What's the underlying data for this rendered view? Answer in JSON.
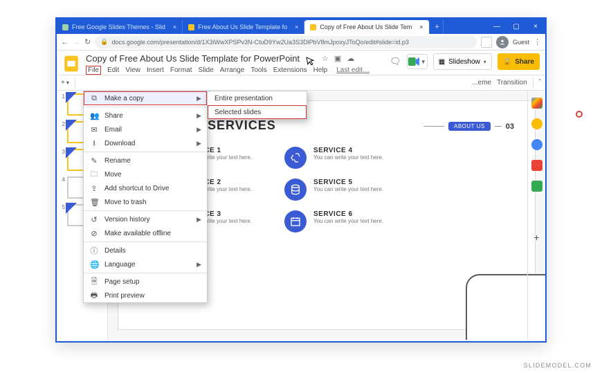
{
  "browser": {
    "tabs": [
      {
        "label": "Free Google Slides Themes - Slid"
      },
      {
        "label": "Free About Us Slide Template fo"
      },
      {
        "label": "Copy of Free About Us Slide Tem"
      }
    ],
    "url": "docs.google.com/presentation/d/1X3iWwXPSPv3N-CtuD9Yw2Ua3S3DlPbV8mJpoxyJToQo/edit#slide=id.p3",
    "guest": "Guest"
  },
  "doc": {
    "title": "Copy of Free About Us Slide Template for PowerPoint",
    "menus": [
      "File",
      "Edit",
      "View",
      "Insert",
      "Format",
      "Slide",
      "Arrange",
      "Tools",
      "Extensions",
      "Help"
    ],
    "last_edit": "Last edit…",
    "slideshow": "Slideshow",
    "share": "Share"
  },
  "file_menu": {
    "make_copy": "Make a copy",
    "share": "Share",
    "email": "Email",
    "download": "Download",
    "rename": "Rename",
    "move": "Move",
    "shortcut": "Add shortcut to Drive",
    "trash": "Move to trash",
    "version": "Version history",
    "offline": "Make available offline",
    "details": "Details",
    "language": "Language",
    "pagesetup": "Page setup",
    "printpreview": "Print preview"
  },
  "submenu": {
    "entire": "Entire presentation",
    "selected": "Selected slides"
  },
  "toolbar": {
    "theme": "...eme",
    "transition": "Transition"
  },
  "slide": {
    "heading": "OUR SERVICES",
    "badge": "ABOUT US",
    "badgenum": "03",
    "services": [
      {
        "title": "SERVICE 1",
        "desc": "You can write\nyour text here."
      },
      {
        "title": "SERVICE 4",
        "desc": "You can write\nyour text here."
      },
      {
        "title": "SERVICE 2",
        "desc": "You can write\nyour text here."
      },
      {
        "title": "SERVICE 5",
        "desc": "You can write\nyour text here."
      },
      {
        "title": "SERVICE 3",
        "desc": "You can write\nyour text here."
      },
      {
        "title": "SERVICE 6",
        "desc": "You can write\nyour text here."
      }
    ]
  },
  "thumbs": [
    "1",
    "2",
    "3",
    "4",
    "5"
  ],
  "brand": "SLIDEMODEL.COM"
}
